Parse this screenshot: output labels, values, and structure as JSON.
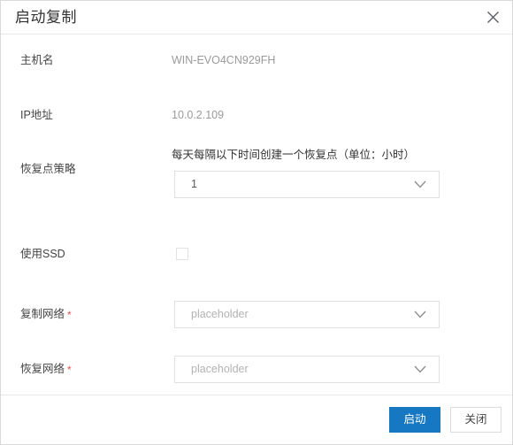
{
  "dialog": {
    "title": "启动复制",
    "close_icon": "close-icon"
  },
  "fields": {
    "hostname": {
      "label": "主机名",
      "value": "WIN-EVO4CN929FH"
    },
    "ip_address": {
      "label": "IP地址",
      "value": "10.0.2.109"
    },
    "recovery_policy": {
      "label": "恢复点策略",
      "description": "每天每隔以下时间创建一个恢复点（单位：小时）",
      "selected": "1",
      "chevron_icon": "chevron-down-icon"
    },
    "use_ssd": {
      "label": "使用SSD",
      "checked": false
    },
    "replication_network": {
      "label": "复制网络",
      "required_mark": "*",
      "placeholder": "placeholder",
      "selected": "placeholder",
      "chevron_icon": "chevron-down-icon"
    },
    "recovery_network": {
      "label": "恢复网络",
      "required_mark": "*",
      "placeholder": "placeholder",
      "selected": "placeholder",
      "chevron_icon": "chevron-down-icon"
    }
  },
  "footer": {
    "primary_label": "启动",
    "close_label": "关闭"
  },
  "colors": {
    "primary": "#1678c2",
    "required": "#e8504a",
    "border": "#e0e0e0"
  }
}
